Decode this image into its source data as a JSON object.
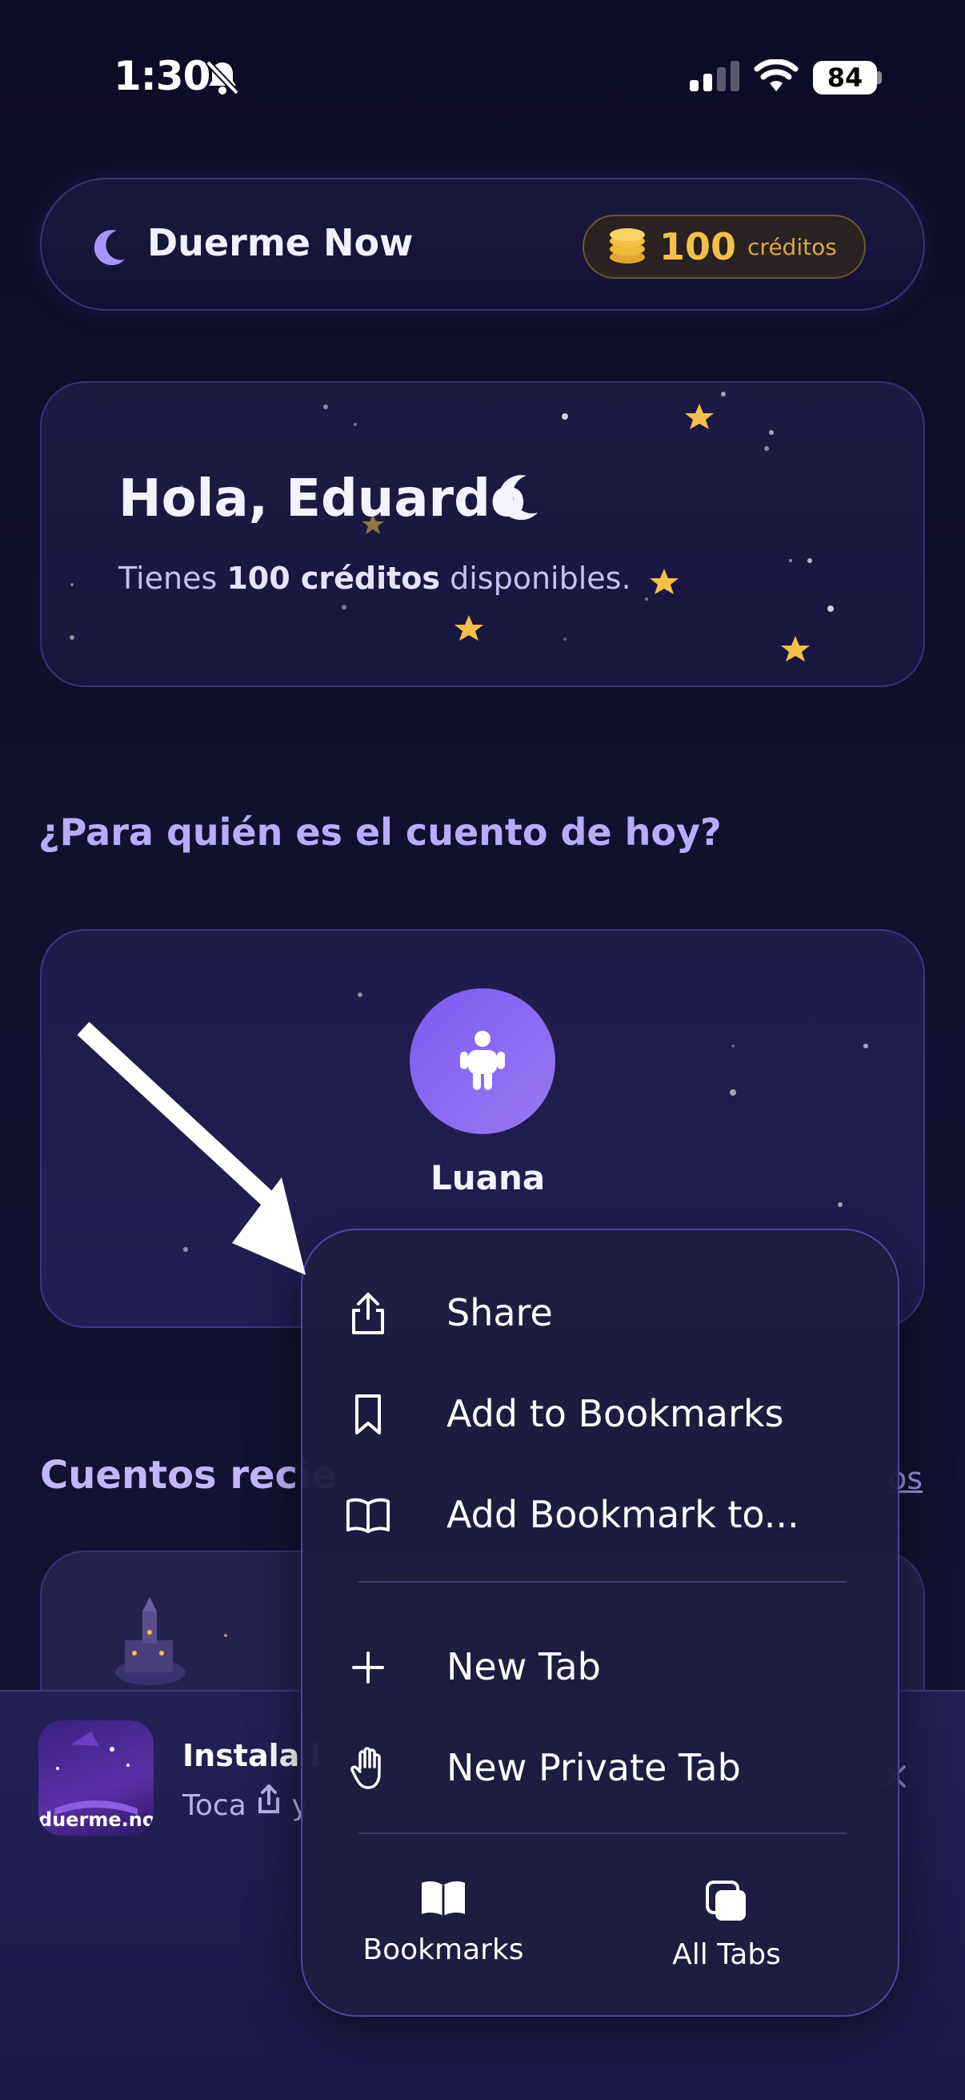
{
  "status_bar": {
    "time": "1:30",
    "battery": "84"
  },
  "header": {
    "app_name": "Duerme Now",
    "credits_value": "100",
    "credits_label": "créditos"
  },
  "greeting": {
    "title": "Hola, Eduardo",
    "sub_prefix": "Tienes ",
    "sub_bold": "100 créditos",
    "sub_suffix": " disponibles."
  },
  "question": "¿Para quién es el cuento de hoy?",
  "child": {
    "name": "Luana"
  },
  "recent": {
    "title": "Cuentos recie",
    "see_all": "os"
  },
  "install_banner": {
    "icon_label": "duerme.now",
    "title": "Instala l",
    "sub_prefix": "Toca",
    "sub_suffix": "y"
  },
  "context_menu": {
    "items": [
      {
        "label": "Share",
        "icon": "share-icon"
      },
      {
        "label": "Add to Bookmarks",
        "icon": "bookmark-icon"
      },
      {
        "label": "Add Bookmark to...",
        "icon": "open-book-icon"
      },
      {
        "label": "New Tab",
        "icon": "plus-icon"
      },
      {
        "label": "New Private Tab",
        "icon": "hand-icon"
      }
    ],
    "bottom": [
      {
        "label": "Bookmarks",
        "icon": "bookmarks-book-icon"
      },
      {
        "label": "All Tabs",
        "icon": "all-tabs-icon"
      }
    ]
  },
  "colors": {
    "background": "#0d0c27",
    "accent": "#b9abff",
    "gold": "#f4c04a",
    "avatar": "#8a6af2"
  }
}
